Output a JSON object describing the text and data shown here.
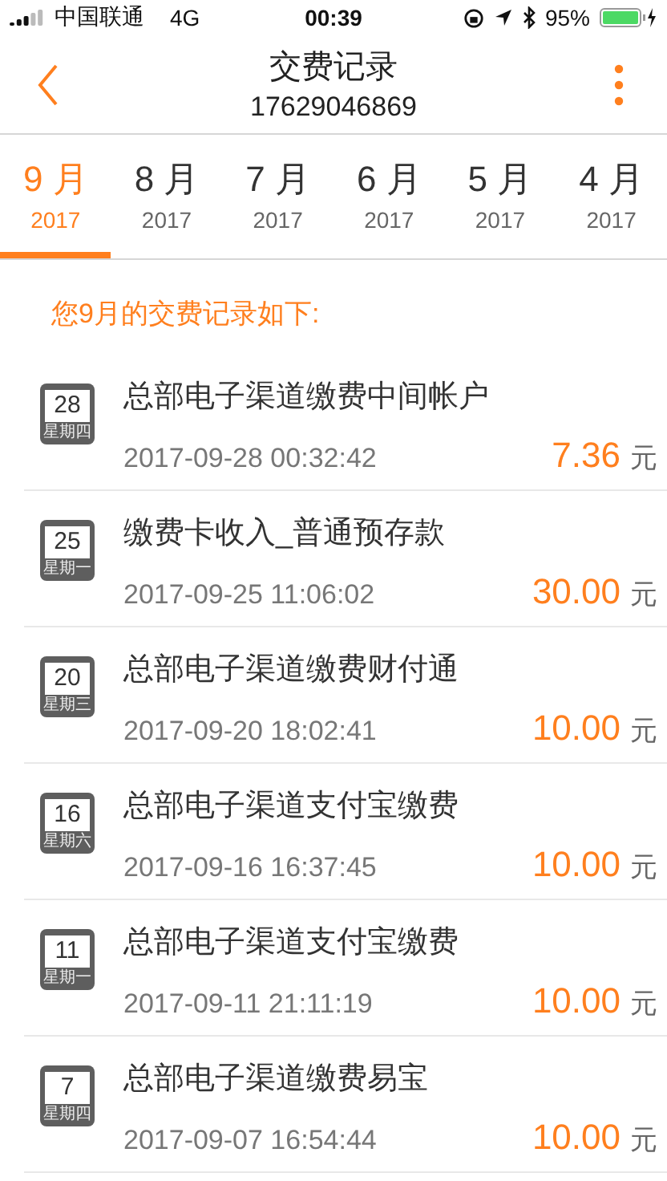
{
  "status_bar": {
    "carrier": "中国联通",
    "network": "4G",
    "time": "00:39",
    "battery": "95%"
  },
  "header": {
    "title": "交费记录",
    "subtitle": "17629046869"
  },
  "months": [
    {
      "month": "9 月",
      "year": "2017",
      "selected": true
    },
    {
      "month": "8 月",
      "year": "2017",
      "selected": false
    },
    {
      "month": "7 月",
      "year": "2017",
      "selected": false
    },
    {
      "month": "6 月",
      "year": "2017",
      "selected": false
    },
    {
      "month": "5 月",
      "year": "2017",
      "selected": false
    },
    {
      "month": "4 月",
      "year": "2017",
      "selected": false
    }
  ],
  "summary": "您9月的交费记录如下:",
  "records": [
    {
      "day": "28",
      "weekday": "星期四",
      "name": "总部电子渠道缴费中间帐户",
      "time": "2017-09-28 00:32:42",
      "amount": "7.36",
      "unit": "元"
    },
    {
      "day": "25",
      "weekday": "星期一",
      "name": "缴费卡收入_普通预存款",
      "time": "2017-09-25 11:06:02",
      "amount": "30.00",
      "unit": "元"
    },
    {
      "day": "20",
      "weekday": "星期三",
      "name": "总部电子渠道缴费财付通",
      "time": "2017-09-20 18:02:41",
      "amount": "10.00",
      "unit": "元"
    },
    {
      "day": "16",
      "weekday": "星期六",
      "name": "总部电子渠道支付宝缴费",
      "time": "2017-09-16 16:37:45",
      "amount": "10.00",
      "unit": "元"
    },
    {
      "day": "11",
      "weekday": "星期一",
      "name": "总部电子渠道支付宝缴费",
      "time": "2017-09-11 21:11:19",
      "amount": "10.00",
      "unit": "元"
    },
    {
      "day": "7",
      "weekday": "星期四",
      "name": "总部电子渠道缴费易宝",
      "time": "2017-09-07 16:54:44",
      "amount": "10.00",
      "unit": "元"
    }
  ]
}
